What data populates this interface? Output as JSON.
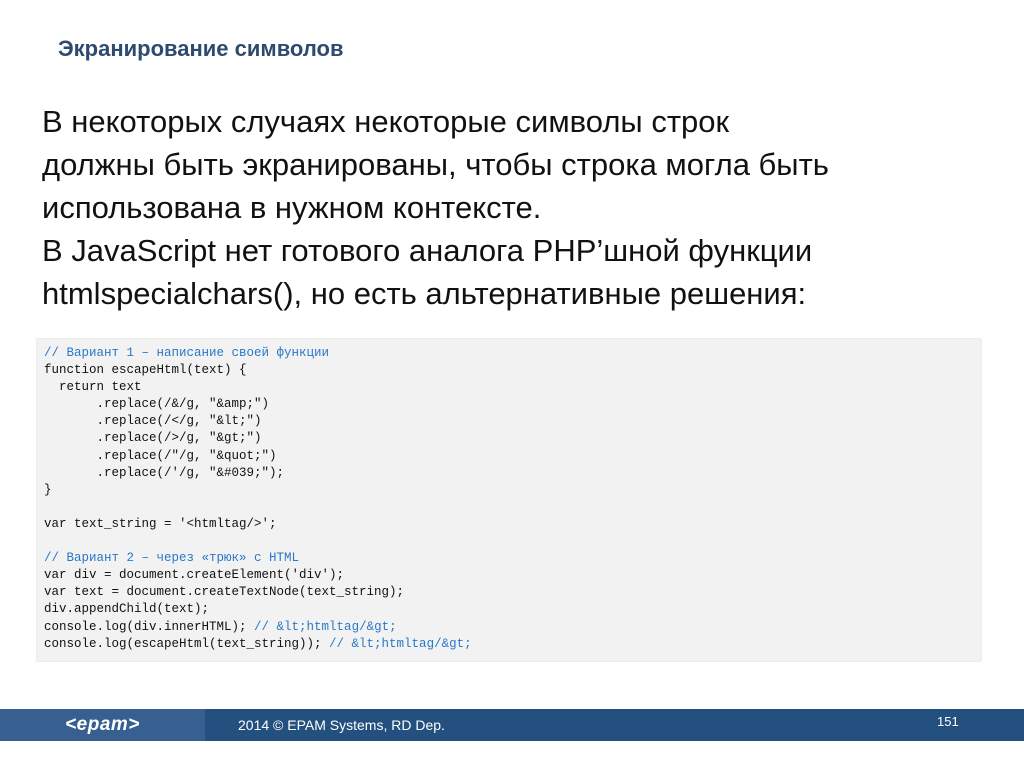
{
  "slide": {
    "title": "Экранирование символов",
    "paragraphs": [
      "В некоторых случаях некоторые символы строк",
      "должны быть экранированы, чтобы строка могла быть",
      "использована в нужном контексте.",
      "В JavaScript нет готового аналога PHP’шной функции",
      "htmlspecialchars(), но есть альтернативные решения:"
    ]
  },
  "code_lines": [
    {
      "code": "",
      "comment": "// Вариант 1 – написание своей функции"
    },
    {
      "code": "function escapeHtml(text) {",
      "comment": ""
    },
    {
      "code": "  return text",
      "comment": ""
    },
    {
      "code": "       .replace(/&/g, \"&amp;\")",
      "comment": ""
    },
    {
      "code": "       .replace(/</g, \"&lt;\")",
      "comment": ""
    },
    {
      "code": "       .replace(/>/g, \"&gt;\")",
      "comment": ""
    },
    {
      "code": "       .replace(/\"/g, \"&quot;\")",
      "comment": ""
    },
    {
      "code": "       .replace(/'/g, \"&#039;\");",
      "comment": ""
    },
    {
      "code": "}",
      "comment": ""
    },
    {
      "code": "",
      "comment": ""
    },
    {
      "code": "var text_string = '<htmltag/>';",
      "comment": ""
    },
    {
      "code": "",
      "comment": ""
    },
    {
      "code": "",
      "comment": "// Вариант 2 – через «трюк» с HTML"
    },
    {
      "code": "var div = document.createElement('div');",
      "comment": ""
    },
    {
      "code": "var text = document.createTextNode(text_string);",
      "comment": ""
    },
    {
      "code": "div.appendChild(text);",
      "comment": ""
    },
    {
      "code": "console.log(div.innerHTML); ",
      "comment": "// &lt;htmltag/&gt;"
    },
    {
      "code": "console.log(escapeHtml(text_string)); ",
      "comment": "// &lt;htmltag/&gt;"
    }
  ],
  "footer": {
    "logo": "<epam>",
    "copyright": "2014 © EPAM Systems, RD Dep.",
    "page_number": "151"
  },
  "colors": {
    "title": "#2d4a6f",
    "comment": "#2a78c8",
    "footer_bg": "#24507f",
    "logo_bg": "#375f8f",
    "code_bg": "#f2f2f2"
  }
}
